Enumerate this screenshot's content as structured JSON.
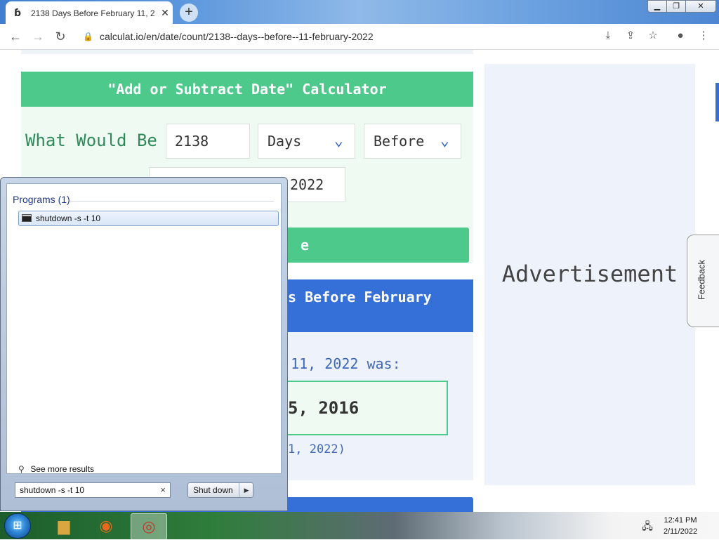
{
  "browser": {
    "tab_title": "2138 Days Before February 11, 2",
    "tab_close": "✕",
    "new_tab": "+",
    "url": "calculat.io/en/date/count/2138--days--before--11-february-2022"
  },
  "calculator": {
    "header": "\"Add or Subtract Date\" Calculator",
    "label": "What Would Be",
    "amount": "2138",
    "unit": "Days",
    "direction": "Before",
    "date_year_visible": "2022",
    "button": "e"
  },
  "result": {
    "title": "s Before February",
    "question": "y 11, 2022 was:",
    "answer": "5, 2016",
    "note": "1, 2022)"
  },
  "ad": {
    "label": "Advertisement"
  },
  "feedback": {
    "label": "Feedback"
  },
  "start_menu": {
    "programs_header": "Programs (1)",
    "program_item": "shutdown -s -t 10",
    "see_more": "See more results",
    "search_value": "shutdown -s -t 10",
    "shutdown_button": "Shut down"
  },
  "taskbar": {
    "time": "12:41 PM",
    "date": "2/11/2022"
  },
  "icons": {
    "favicon": "calculat-favicon",
    "back": "back-arrow-icon",
    "forward": "forward-arrow-icon",
    "reload": "reload-icon",
    "lock": "lock-icon",
    "install": "install-icon",
    "share": "share-icon",
    "star": "star-icon",
    "profile": "profile-icon",
    "menu": "kebab-menu-icon"
  },
  "colors": {
    "calc_green": "#4cc98b",
    "result_blue": "#356fd8",
    "label_green": "#2e8a5a",
    "chevron_blue": "#3465c8"
  }
}
